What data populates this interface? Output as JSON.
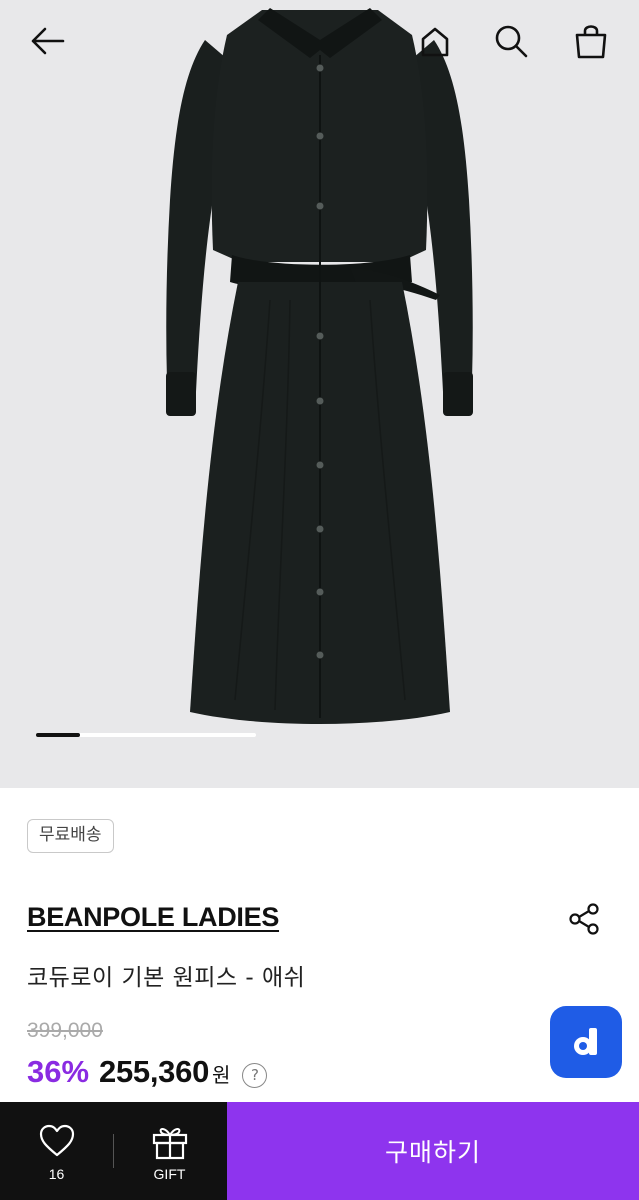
{
  "header": {
    "back_icon": "arrow-left-icon",
    "home_icon": "home-icon",
    "search_icon": "search-icon",
    "cart_icon": "shopping-bag-icon"
  },
  "gallery": {
    "image_subject": "black corduroy long-sleeve shirt dress with belt",
    "progress": 0.2
  },
  "product": {
    "badge": "무료배송",
    "brand": "BEANPOLE LADIES",
    "name": "코듀로이 기본 원피스 - 애쉬",
    "original_price": "399,000",
    "discount": "36%",
    "price": "255,360",
    "currency": "원",
    "help": "?"
  },
  "floating": {
    "logo_letter": "d",
    "logo_color": "#1f5ce6"
  },
  "bottom_bar": {
    "like_count": "16",
    "gift_label": "GIFT",
    "buy_label": "구매하기",
    "buy_color": "#8e34ee"
  }
}
